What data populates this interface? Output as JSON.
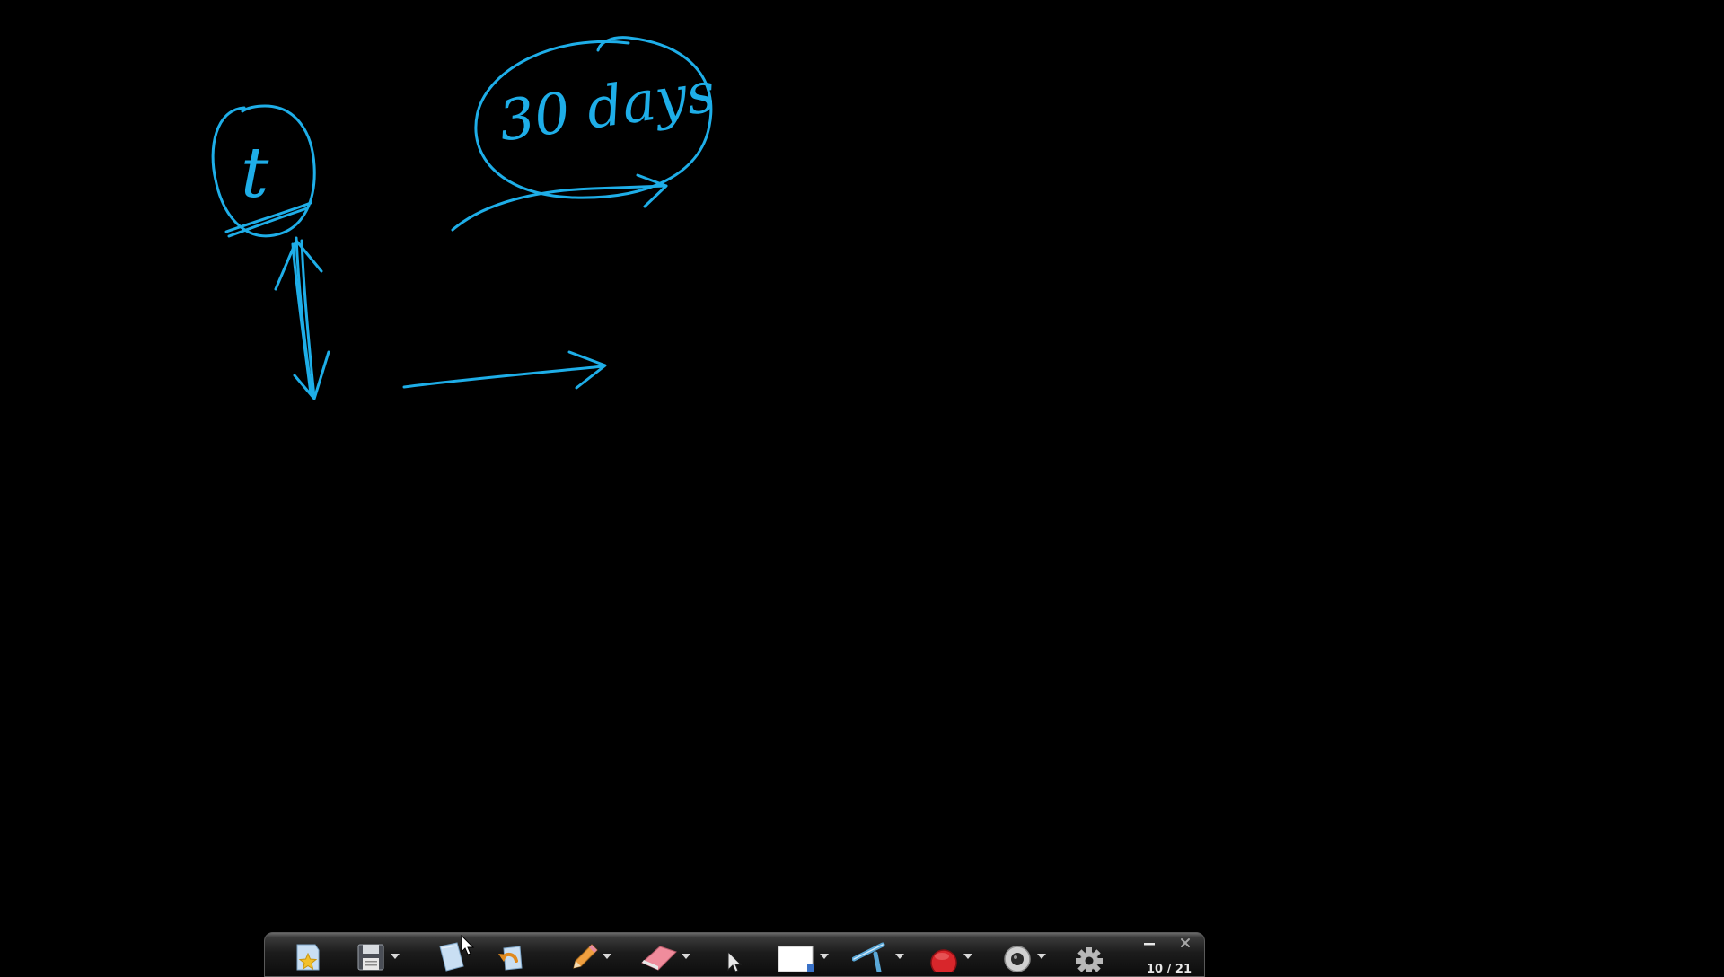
{
  "canvas": {
    "background": "#000000",
    "ink_color": "#1eaee8"
  },
  "annotations": {
    "circled_letter": "t",
    "circled_note": "30 days"
  },
  "toolbar": {
    "tools": [
      {
        "name": "favorites",
        "icon": "star-page-icon",
        "has_dropdown": false
      },
      {
        "name": "save",
        "icon": "floppy-save-icon",
        "has_dropdown": true
      },
      {
        "name": "new-page",
        "icon": "blank-page-icon",
        "has_dropdown": false
      },
      {
        "name": "undo",
        "icon": "undo-arrow-icon",
        "has_dropdown": false
      },
      {
        "name": "pen",
        "icon": "pencil-icon",
        "has_dropdown": true
      },
      {
        "name": "eraser",
        "icon": "eraser-icon",
        "has_dropdown": true
      },
      {
        "name": "select",
        "icon": "pointer-arrow-icon",
        "has_dropdown": false
      },
      {
        "name": "background",
        "icon": "white-rectangle-icon",
        "has_dropdown": true
      },
      {
        "name": "line",
        "icon": "line-tool-icon",
        "has_dropdown": true
      },
      {
        "name": "record",
        "icon": "record-circle-icon",
        "has_dropdown": true
      },
      {
        "name": "webcam",
        "icon": "webcam-icon",
        "has_dropdown": true
      },
      {
        "name": "settings",
        "icon": "gear-icon",
        "has_dropdown": false
      }
    ],
    "page_counter": "10 / 21",
    "colors": {
      "record": "#d8262b",
      "pen": "#f0a040",
      "eraser": "#f08c9c"
    }
  }
}
